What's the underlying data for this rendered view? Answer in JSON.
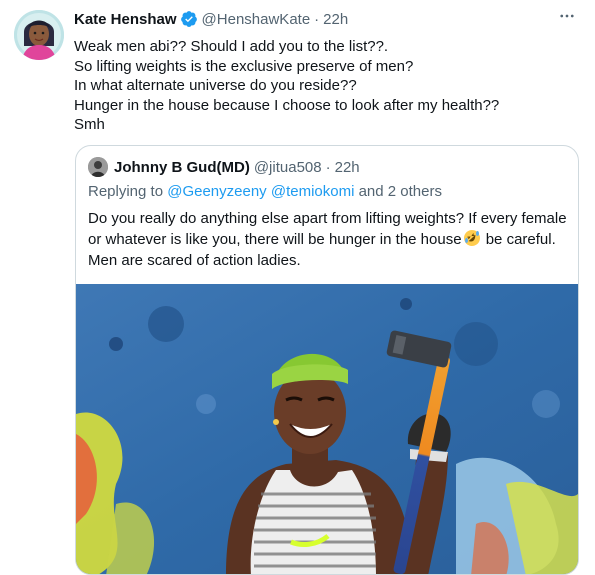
{
  "tweet": {
    "author_name": "Kate Henshaw",
    "author_handle": "@HenshawKate",
    "separator": "·",
    "time": "22h",
    "more_glyph": "···",
    "lines": [
      "Weak men abi?? Should I add you to the list??.",
      "So lifting weights is the exclusive preserve of men?",
      "In what alternate universe do you reside??",
      "Hunger in the house because I choose to look after my health??",
      "Smh"
    ]
  },
  "quote": {
    "author_name": "Johnny B Gud(MD)",
    "author_handle": "@jitua508",
    "separator": "·",
    "time": "22h",
    "reply_prefix": "Replying to ",
    "reply_mention_1": "@Geenyzeeny",
    "reply_mention_2": "@temiokomi",
    "reply_suffix": " and 2 others",
    "line1": "Do you really do anything else apart from lifting weights? If every female",
    "line2_a": "or whatever is like you, there will be hunger in the house",
    "line2_emoji": "rolling-on-floor-laughing-emoji",
    "line2_b": " be careful.",
    "line3": "Men are scared of action ladies."
  },
  "colors": {
    "text": "#0f1419",
    "secondary": "#536471",
    "link": "#1d9bf0",
    "border": "#cfd9de"
  },
  "icons": {
    "verified": "verified-badge-icon",
    "more": "more-icon"
  }
}
